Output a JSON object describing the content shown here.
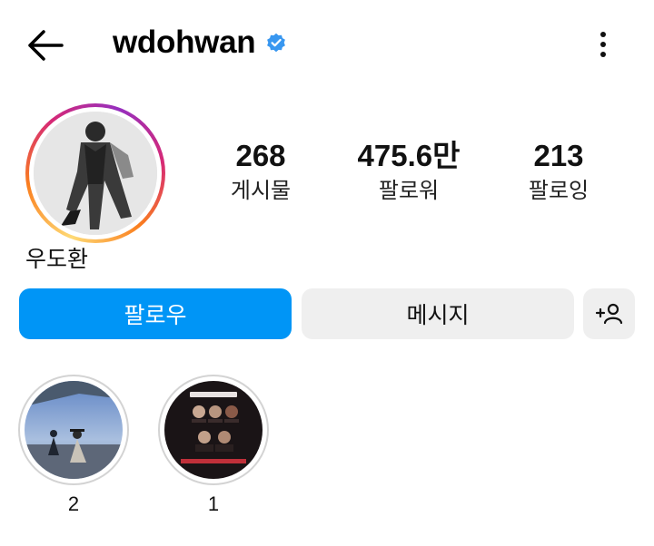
{
  "header": {
    "back_icon": "arrow-left-icon",
    "username": "wdohwan",
    "verified_icon": "verified-badge-icon",
    "more_icon": "more-vertical-icon"
  },
  "profile": {
    "display_name": "우도환",
    "stats": [
      {
        "value": "268",
        "label": "게시물"
      },
      {
        "value": "475.6만",
        "label": "팔로워"
      },
      {
        "value": "213",
        "label": "팔로잉"
      }
    ]
  },
  "actions": {
    "follow_label": "팔로우",
    "message_label": "메시지",
    "add_person_icon": "add-person-icon"
  },
  "highlights": [
    {
      "label": "2"
    },
    {
      "label": "1"
    }
  ],
  "colors": {
    "accent": "#0095f6",
    "verified": "#3897f0",
    "secondary_button": "#efefef"
  }
}
